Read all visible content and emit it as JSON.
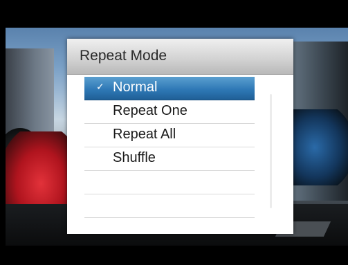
{
  "dialog": {
    "title": "Repeat Mode",
    "items": [
      {
        "label": "Normal",
        "selected": true,
        "check": "✓"
      },
      {
        "label": "Repeat One",
        "selected": false
      },
      {
        "label": "Repeat All",
        "selected": false
      },
      {
        "label": "Shuffle",
        "selected": false
      },
      {
        "label": "",
        "selected": false
      },
      {
        "label": "",
        "selected": false
      }
    ]
  },
  "colors": {
    "selection": "#2f79b6",
    "header": "#d4d4d4"
  }
}
